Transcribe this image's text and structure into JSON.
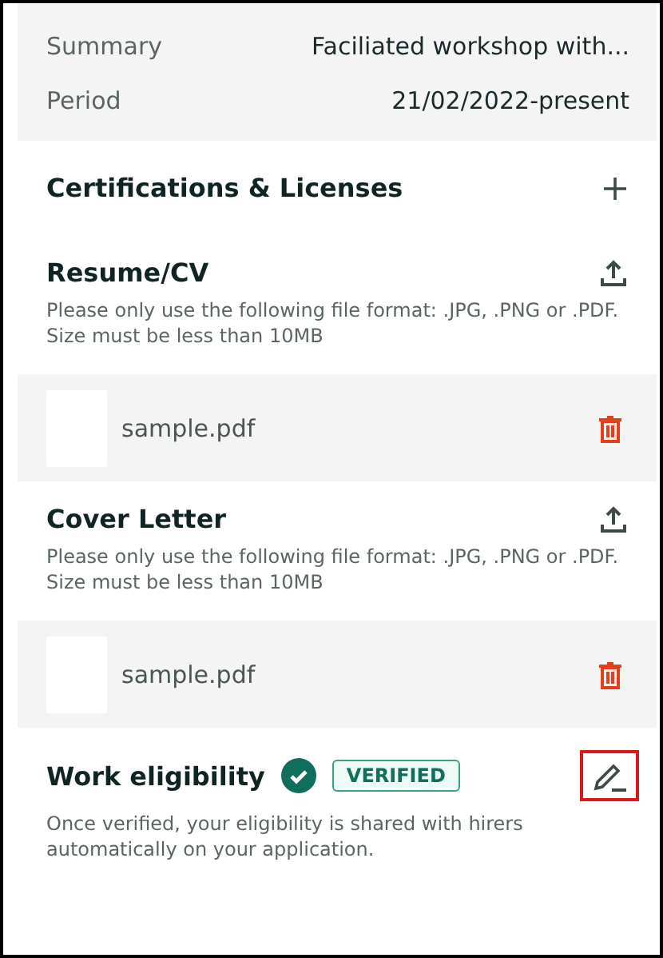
{
  "summary_rows": [
    {
      "label": "Summary",
      "value": "Faciliated workshop with..."
    },
    {
      "label": "Period",
      "value": "21/02/2022-present"
    }
  ],
  "sections": [
    {
      "kind": "add",
      "title": "Certifications & Licenses"
    },
    {
      "kind": "upload",
      "title": "Resume/CV",
      "description": "Please only use the following file format: .JPG, .PNG or .PDF. Size must be less than 10MB",
      "file": {
        "name": "sample.pdf"
      }
    },
    {
      "kind": "upload",
      "title": "Cover Letter",
      "description": "Please only use the following file format: .JPG, .PNG or .PDF. Size must be less than 10MB",
      "file": {
        "name": "sample.pdf"
      }
    },
    {
      "kind": "eligibility",
      "title": "Work eligibility",
      "verified": true,
      "badge": "VERIFIED",
      "description": "Once verified, your eligibility is shared with hirers automatically on your application.",
      "edit_highlighted": true
    }
  ]
}
